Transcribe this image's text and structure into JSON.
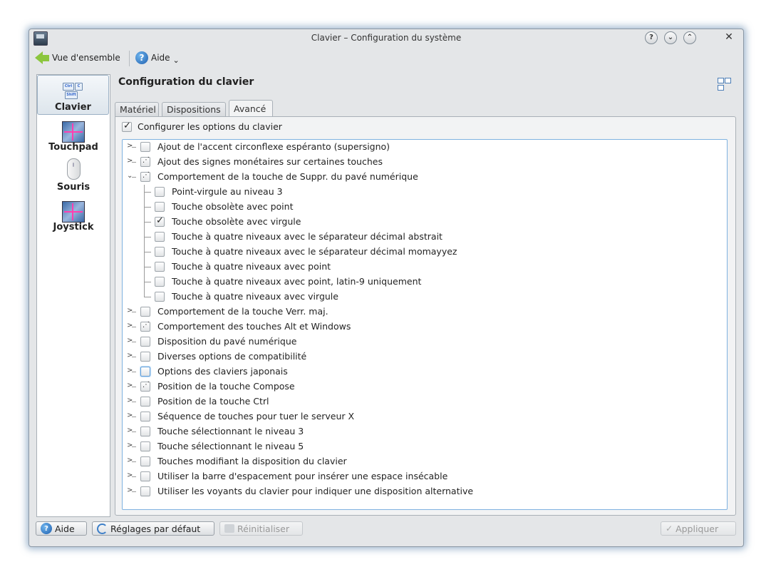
{
  "window": {
    "title": "Clavier – Configuration du système",
    "buttons": {
      "help": "?",
      "minimize": "⌄",
      "maximize": "⌃",
      "close": "✕"
    }
  },
  "toolbar": {
    "overview_label": "Vue d'ensemble",
    "help_label": "Aide",
    "help_dropdown": "⌄"
  },
  "sidebar": {
    "items": [
      {
        "label": "Clavier",
        "icon": "keyboard-icon",
        "selected": true
      },
      {
        "label": "Touchpad",
        "icon": "touchpad-icon",
        "selected": false
      },
      {
        "label": "Souris",
        "icon": "mouse-icon",
        "selected": false
      },
      {
        "label": "Joystick",
        "icon": "joystick-icon",
        "selected": false
      }
    ],
    "keyboard_keys": [
      "Ctrl",
      "C",
      "Shift"
    ]
  },
  "header": {
    "title": "Configuration du clavier"
  },
  "tabs": [
    {
      "label": "Matériel",
      "active": false
    },
    {
      "label": "Dispositions",
      "active": false
    },
    {
      "label": "Avancé",
      "active": true
    }
  ],
  "configure_checkbox": {
    "label": "Configurer les options du clavier",
    "checked": true
  },
  "options": [
    {
      "label": "Ajout de l'accent circonflexe espéranto (supersigno)",
      "state": "unchecked",
      "level": 0,
      "expander": ">"
    },
    {
      "label": "Ajout des signes monétaires sur certaines touches",
      "state": "partial",
      "level": 0,
      "expander": ">"
    },
    {
      "label": "Comportement de la touche de Suppr. du pavé numérique",
      "state": "partial",
      "level": 0,
      "expander": "⌄"
    },
    {
      "label": "Point-virgule au niveau 3",
      "state": "unchecked",
      "level": 1
    },
    {
      "label": "Touche obsolète avec point",
      "state": "unchecked",
      "level": 1
    },
    {
      "label": "Touche obsolète avec virgule",
      "state": "checked",
      "level": 1
    },
    {
      "label": "Touche à quatre niveaux avec le séparateur décimal abstrait",
      "state": "unchecked",
      "level": 1
    },
    {
      "label": "Touche à quatre niveaux avec le séparateur décimal momayyez",
      "state": "unchecked",
      "level": 1
    },
    {
      "label": "Touche à quatre niveaux avec point",
      "state": "unchecked",
      "level": 1
    },
    {
      "label": "Touche à quatre niveaux avec point, latin-9 uniquement",
      "state": "unchecked",
      "level": 1
    },
    {
      "label": "Touche à quatre niveaux avec virgule",
      "state": "unchecked",
      "level": 1
    },
    {
      "label": "Comportement de la touche Verr. maj.",
      "state": "unchecked",
      "level": 0,
      "expander": ">"
    },
    {
      "label": "Comportement des touches Alt et Windows",
      "state": "partial",
      "level": 0,
      "expander": ">"
    },
    {
      "label": "Disposition du pavé numérique",
      "state": "unchecked",
      "level": 0,
      "expander": ">"
    },
    {
      "label": "Diverses options de compatibilité",
      "state": "unchecked",
      "level": 0,
      "expander": ">"
    },
    {
      "label": "Options des claviers japonais",
      "state": "focus",
      "level": 0,
      "expander": ">"
    },
    {
      "label": "Position de la touche Compose",
      "state": "partial",
      "level": 0,
      "expander": ">"
    },
    {
      "label": "Position de la touche Ctrl",
      "state": "unchecked",
      "level": 0,
      "expander": ">"
    },
    {
      "label": "Séquence de touches pour tuer le serveur X",
      "state": "unchecked",
      "level": 0,
      "expander": ">"
    },
    {
      "label": "Touche sélectionnant le niveau 3",
      "state": "unchecked",
      "level": 0,
      "expander": ">"
    },
    {
      "label": "Touche sélectionnant le niveau 5",
      "state": "unchecked",
      "level": 0,
      "expander": ">"
    },
    {
      "label": "Touches modifiant la disposition du clavier",
      "state": "unchecked",
      "level": 0,
      "expander": ">"
    },
    {
      "label": "Utiliser la barre d'espacement pour insérer une espace insécable",
      "state": "unchecked",
      "level": 0,
      "expander": ">"
    },
    {
      "label": "Utiliser les voyants du clavier pour indiquer une disposition alternative",
      "state": "unchecked",
      "level": 0,
      "expander": ">"
    }
  ],
  "bottom": {
    "help_label": "Aide",
    "defaults_label": "Réglages par défaut",
    "reset_label": "Réinitialiser",
    "apply_label": "Appliquer"
  },
  "colors": {
    "accent": "#1f5fae",
    "selection_border": "#7fb2e0",
    "back_arrow": "#8cc63e"
  }
}
